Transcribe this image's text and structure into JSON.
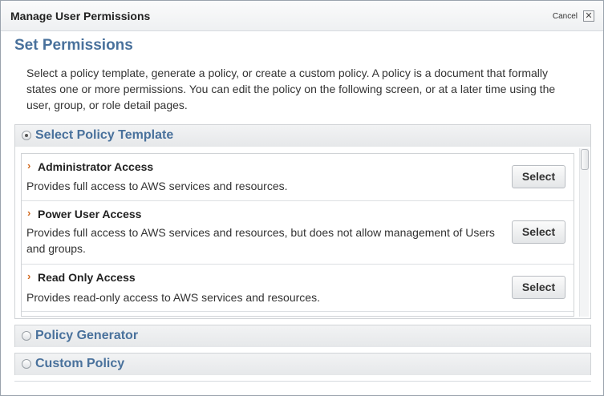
{
  "dialog": {
    "title": "Manage User Permissions",
    "cancel_label": "Cancel",
    "close_glyph": "✕"
  },
  "heading": "Set Permissions",
  "intro": "Select a policy template, generate a policy, or create a custom policy. A policy is a document that formally states one or more permissions. You can edit the policy on the following screen, or at a later time using the user, group, or role detail pages.",
  "sections": {
    "template": {
      "label": "Select Policy Template",
      "selected": true,
      "items": [
        {
          "name": "Administrator Access",
          "description": "Provides full access to AWS services and resources.",
          "button": "Select"
        },
        {
          "name": "Power User Access",
          "description": "Provides full access to AWS services and resources, but does not allow management of Users and groups.",
          "button": "Select"
        },
        {
          "name": "Read Only Access",
          "description": "Provides read-only access to AWS services and resources.",
          "button": "Select"
        }
      ]
    },
    "generator": {
      "label": "Policy Generator",
      "selected": false
    },
    "custom": {
      "label": "Custom Policy",
      "selected": false
    }
  },
  "icons": {
    "arrow": "›",
    "accent_color": "#d2691e",
    "heading_color": "#49719c"
  }
}
